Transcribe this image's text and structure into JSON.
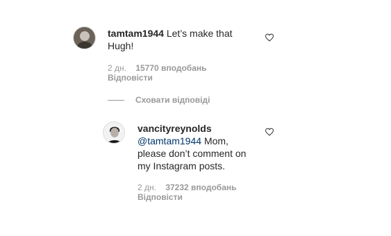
{
  "comment": {
    "username": "tamtam1944",
    "text": "Let’s make that Hugh!",
    "time": "2 дн.",
    "likes": "15770 вподобань",
    "reply_label": "Відповісти"
  },
  "hide_replies_label": "Сховати відповіді",
  "reply": {
    "username": "vancityreynolds",
    "mention": "@tamtam1944",
    "text": "Mom, please don’t comment on my Instagram posts.",
    "time": "2 дн.",
    "likes": "37232 вподобань",
    "reply_label": "Відповісти"
  },
  "icons": {
    "like": "heart-outline-icon"
  },
  "colors": {
    "text": "#262626",
    "secondary": "#999999",
    "mention": "#003569"
  }
}
